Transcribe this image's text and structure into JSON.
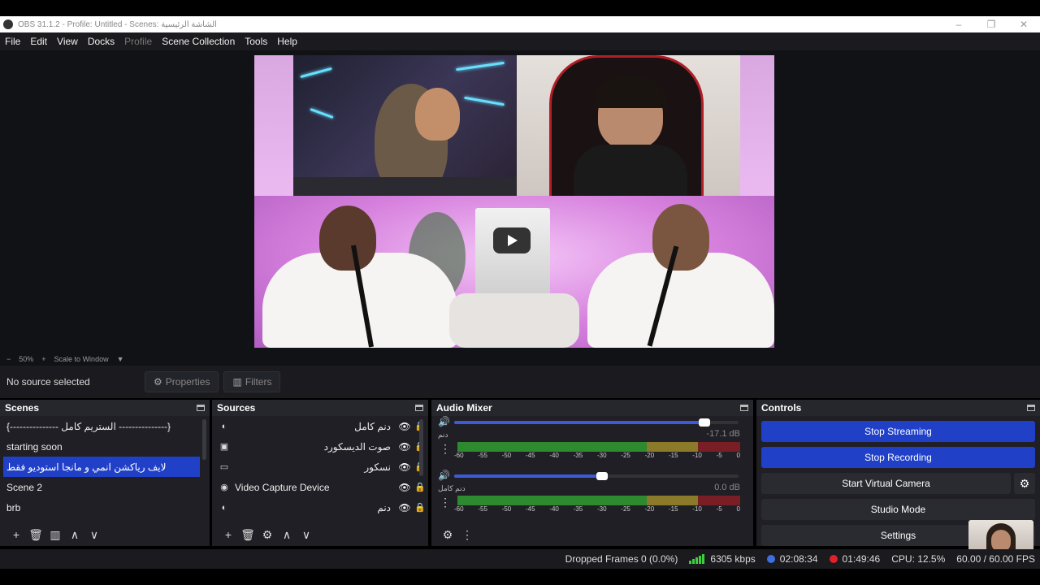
{
  "window": {
    "title": "OBS 31.1.2 - Profile: Untitled - Scenes: الشاشة الرئيسية",
    "minimize_icon": "–",
    "restore_icon": "❐",
    "close_icon": "✕"
  },
  "menu": [
    "File",
    "Edit",
    "View",
    "Docks",
    "Profile",
    "Scene Collection",
    "Tools",
    "Help"
  ],
  "preview": {
    "zoom_minus": "−",
    "zoom_level": "50%",
    "zoom_plus": "+",
    "scale_mode": "Scale to Window"
  },
  "context_bar": {
    "no_source": "No source selected",
    "properties": "Properties",
    "filters": "Filters"
  },
  "scenes": {
    "title": "Scenes",
    "items": [
      "{--------------- الستريم كامل ---------------}",
      "starting soon",
      "لايف رياكشن انمي و مانجا  استوديو فقط",
      "Scene 2",
      "brb"
    ],
    "active_index": 2
  },
  "sources": {
    "title": "Sources",
    "items": [
      {
        "name": "دنم كامل",
        "icon": "browser-icon",
        "rtl": true,
        "locked": true
      },
      {
        "name": "صوت الديسكورد",
        "icon": "audio-capture-icon",
        "rtl": true,
        "locked": false
      },
      {
        "name": "نسكور",
        "icon": "display-icon",
        "rtl": true,
        "locked": false
      },
      {
        "name": "Video Capture Device",
        "icon": "camera-icon",
        "rtl": false,
        "locked": false
      },
      {
        "name": "دنم",
        "icon": "browser-icon",
        "rtl": true,
        "locked": false
      }
    ]
  },
  "mixer": {
    "title": "Audio Mixer",
    "channels": [
      {
        "label": "دنم",
        "db": "-17.1 dB",
        "volume": 0.88
      },
      {
        "label": "دنم كامل",
        "db": "0.0 dB",
        "volume": 0.52
      }
    ],
    "ticks": [
      "-60",
      "-55",
      "-50",
      "-45",
      "-40",
      "-35",
      "-30",
      "-25",
      "-20",
      "-15",
      "-10",
      "-5",
      "0"
    ]
  },
  "controls": {
    "title": "Controls",
    "stop_streaming": "Stop Streaming",
    "stop_recording": "Stop Recording",
    "start_virtual_camera": "Start Virtual Camera",
    "studio_mode": "Studio Mode",
    "settings": "Settings"
  },
  "status": {
    "dropped_frames": "Dropped Frames 0 (0.0%)",
    "bitrate": "6305 kbps",
    "stream_time": "02:08:34",
    "record_time": "01:49:46",
    "cpu": "CPU: 12.5%",
    "fps": "60.00 / 60.00 FPS"
  },
  "colors": {
    "accent": "#2040c8",
    "record_red": "#e0202a",
    "stream_blue": "#3d6fe0",
    "meter_green": "#2d8a2f"
  }
}
